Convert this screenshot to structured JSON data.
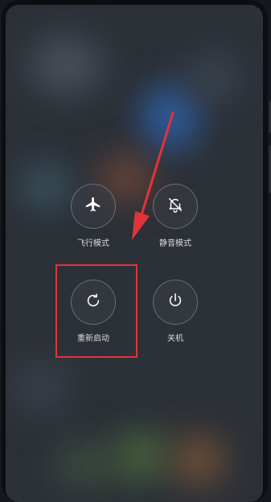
{
  "power_menu": {
    "airplane_mode_label": "飞行模式",
    "silent_mode_label": "静音模式",
    "restart_label": "重新启动",
    "power_off_label": "关机"
  },
  "colors": {
    "highlight_box": "#e0343a",
    "arrow": "#e0343a",
    "label_text": "#d8dbe0"
  },
  "icons": {
    "airplane": "airplane-icon",
    "silent": "bell-off-icon",
    "restart": "restart-icon",
    "power": "power-icon"
  }
}
